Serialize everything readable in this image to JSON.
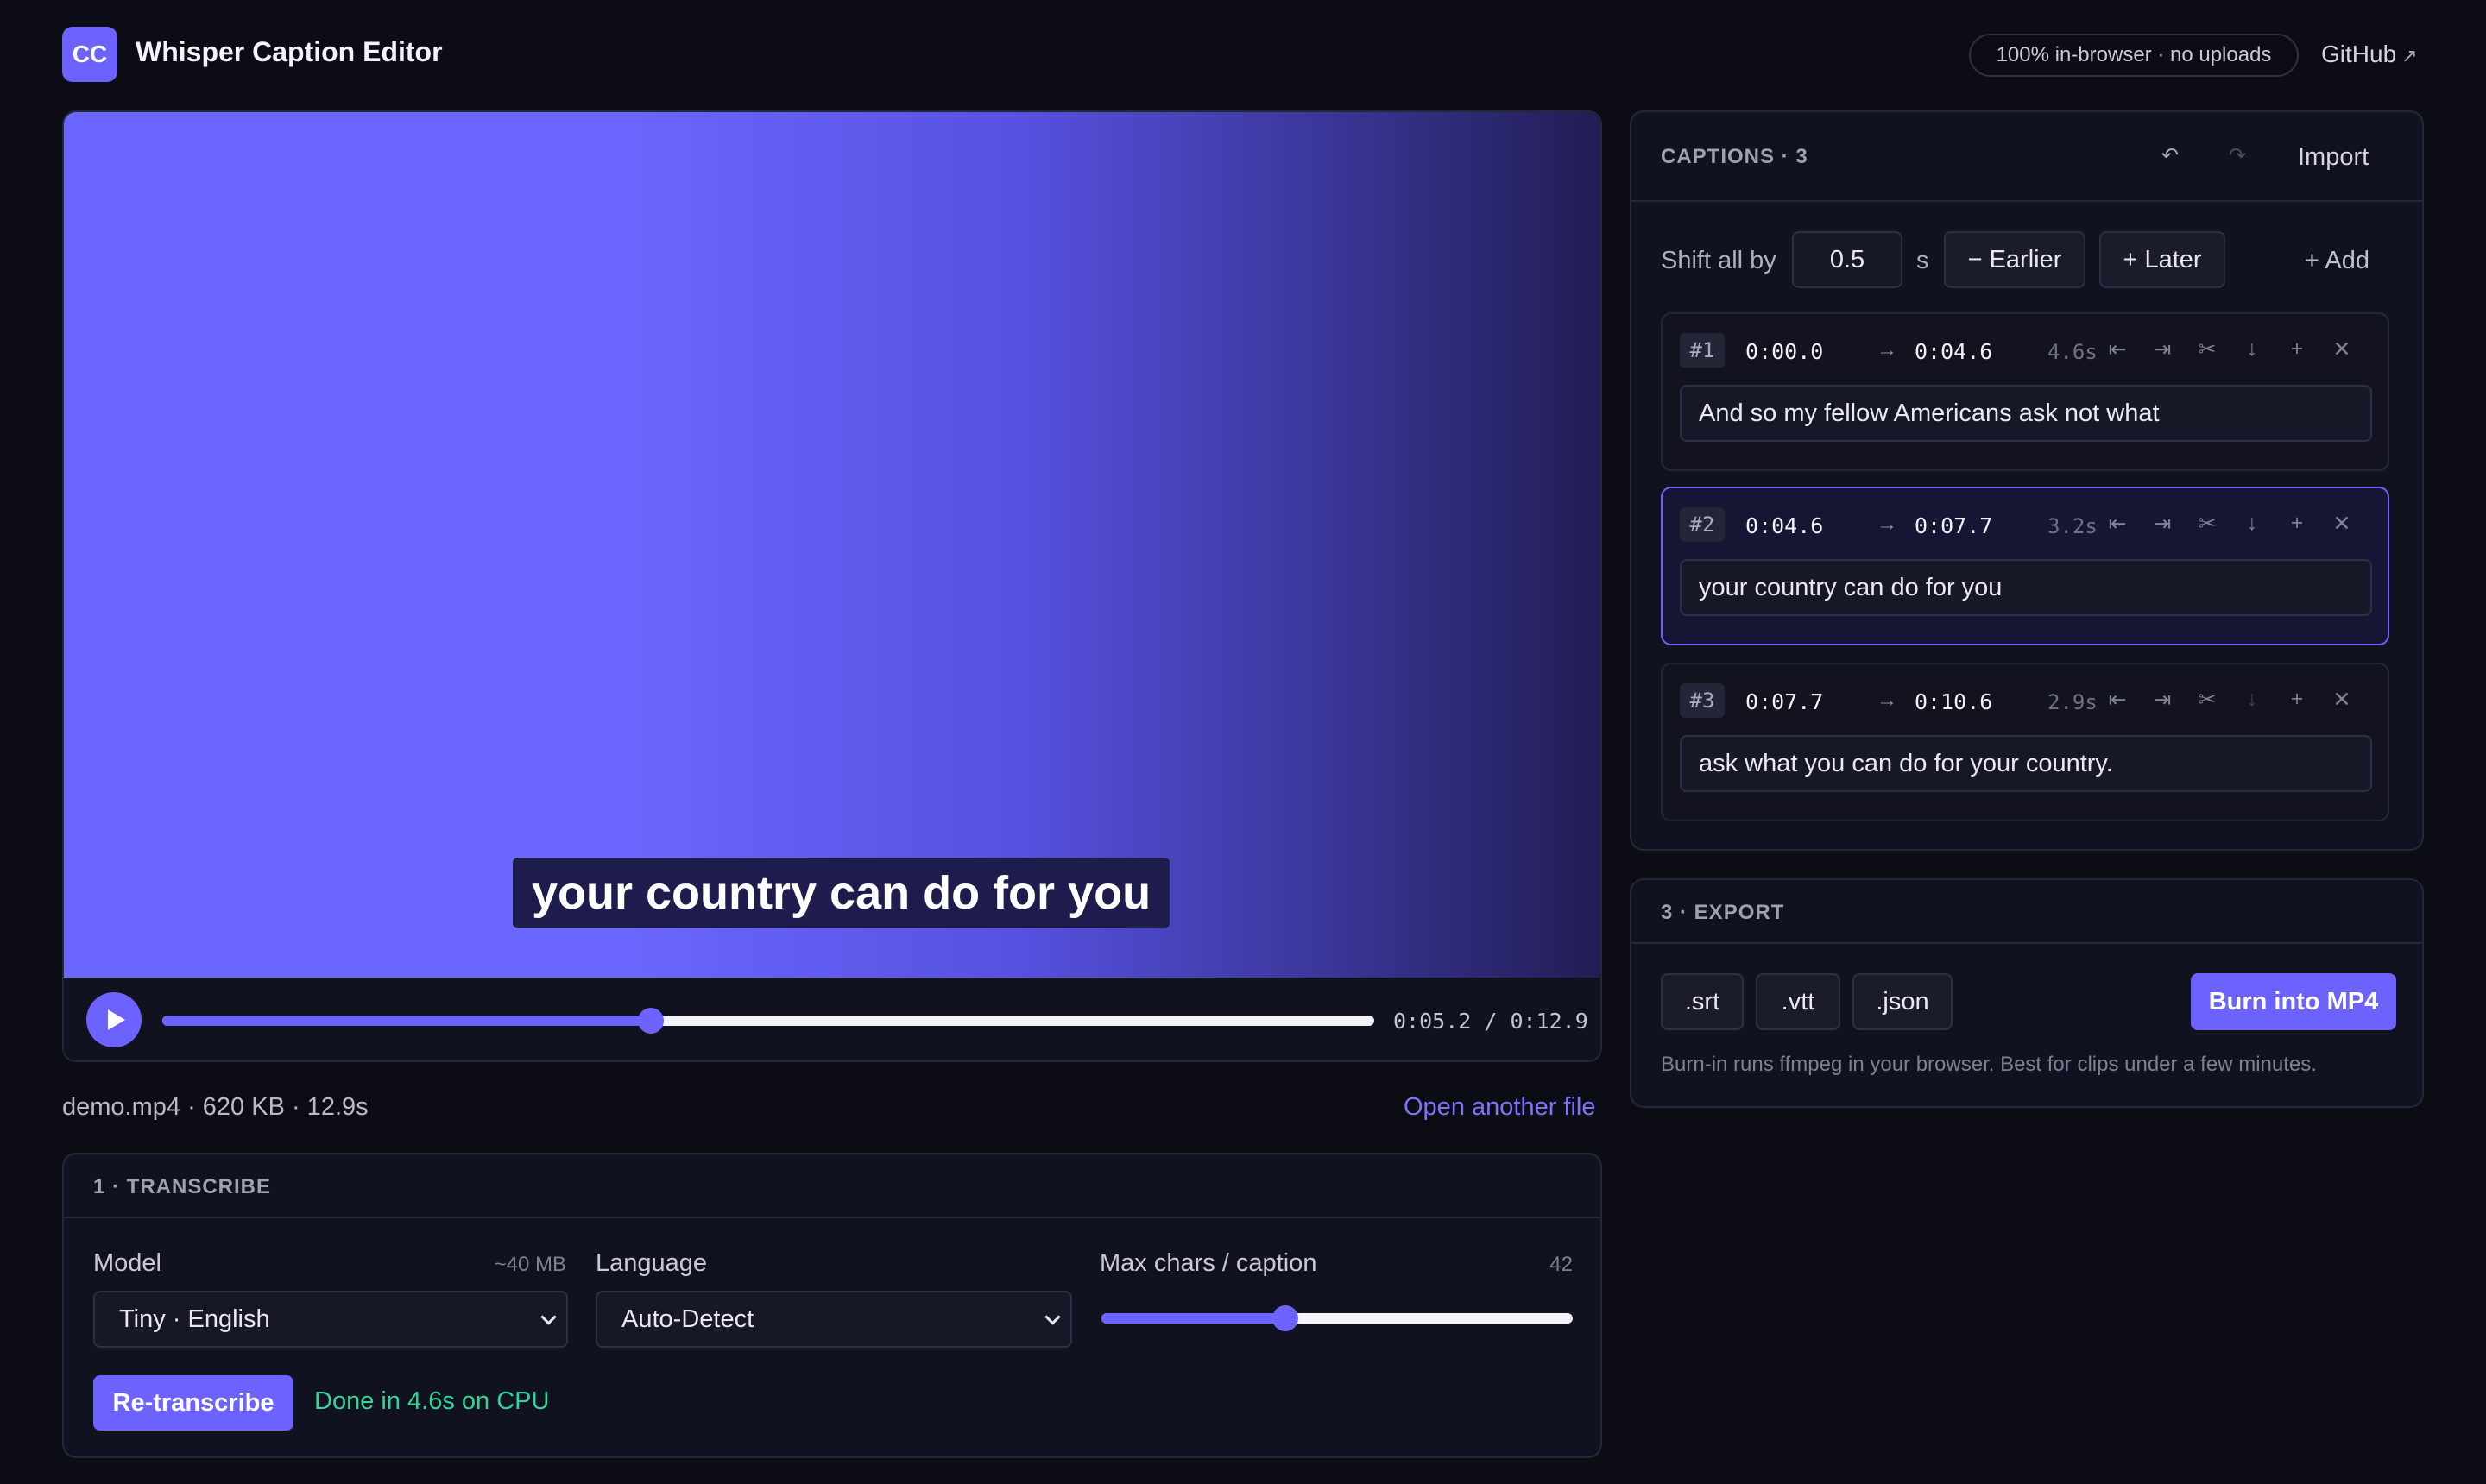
{
  "header": {
    "logo_text": "CC",
    "title": "Whisper Caption Editor",
    "privacy_badge": "100% in-browser · no uploads",
    "github_label": "GitHub",
    "github_arrow": "↗"
  },
  "player": {
    "subtitle": "your country can do for you",
    "time_display": "0:05.2 / 0:12.9",
    "progress_fraction": 0.403,
    "file_info": "demo.mp4 · 620 KB · 12.9s",
    "open_another": "Open another file"
  },
  "transcribe": {
    "section_title": "1 · TRANSCRIBE",
    "model_label": "Model",
    "model_hint": "~40 MB",
    "model_value": "Tiny · English",
    "language_label": "Language",
    "language_value": "Auto-Detect",
    "max_chars_label": "Max chars / caption",
    "max_chars_value": "42",
    "max_chars_fraction": 0.39,
    "retranscribe_label": "Re-transcribe",
    "status": "Done in 4.6s on CPU"
  },
  "captions": {
    "title": "CAPTIONS · 3",
    "undo_icon": "↶",
    "redo_icon": "↷",
    "import_label": "Import",
    "shift_label": "Shift all by",
    "shift_value": "0.5",
    "shift_unit": "s",
    "earlier_label": "− Earlier",
    "later_label": "+ Later",
    "add_label": "+ Add",
    "arrow": "→",
    "tools": [
      "⇤",
      "⇥",
      "✂",
      "↓",
      "+",
      "✕"
    ],
    "items": [
      {
        "index": "#1",
        "start": "0:00.0",
        "end": "0:04.6",
        "duration": "4.6s",
        "text": "And so my fellow Americans ask not what"
      },
      {
        "index": "#2",
        "start": "0:04.6",
        "end": "0:07.7",
        "duration": "3.2s",
        "text": "your country can do for you"
      },
      {
        "index": "#3",
        "start": "0:07.7",
        "end": "0:10.6",
        "duration": "2.9s",
        "text": "ask what you can do for your country."
      }
    ]
  },
  "export": {
    "section_title": "3 · EXPORT",
    "srt_label": ".srt",
    "vtt_label": ".vtt",
    "json_label": ".json",
    "burn_label": "Burn into MP4",
    "note": "Burn-in runs ffmpeg in your browser. Best for clips under a few minutes."
  },
  "colors": {
    "accent": "#6c63ff",
    "success": "#34d399",
    "background": "#0b0c14"
  }
}
